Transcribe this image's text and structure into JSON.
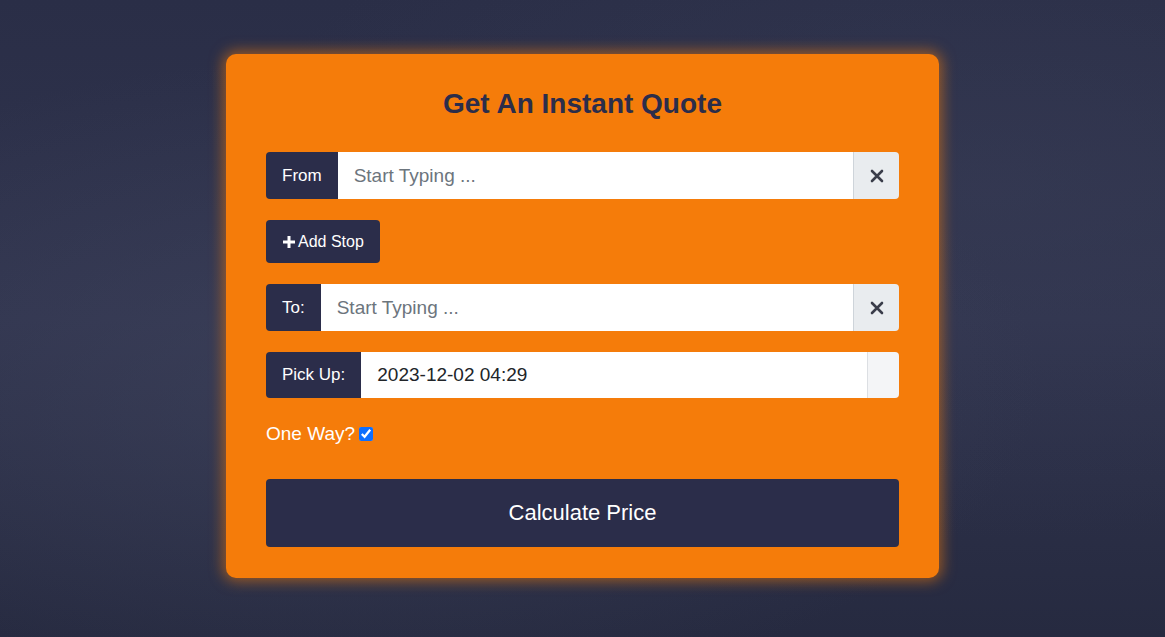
{
  "card": {
    "title": "Get An Instant Quote"
  },
  "from": {
    "label": "From",
    "placeholder": "Start Typing ...",
    "value": ""
  },
  "add_stop": {
    "label": "Add Stop"
  },
  "to": {
    "label": "To:",
    "placeholder": "Start Typing ...",
    "value": ""
  },
  "pickup": {
    "label": "Pick Up:",
    "value": "2023-12-02 04:29"
  },
  "one_way": {
    "label": "One Way?",
    "checked": true
  },
  "submit": {
    "label": "Calculate Price"
  }
}
